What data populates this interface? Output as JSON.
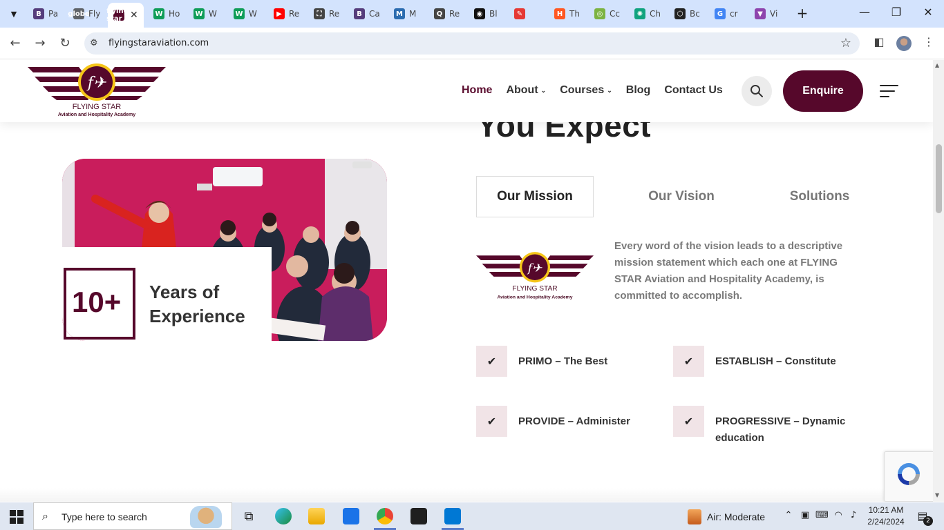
{
  "browser": {
    "tabs": [
      {
        "title": "Pa",
        "favicon": "B",
        "color": "#563d7c"
      },
      {
        "title": "Fly",
        "favicon": "globe",
        "color": "#5f6368"
      },
      {
        "title": "",
        "favicon": "flying-star",
        "color": "#56082b",
        "active": true
      },
      {
        "title": "Ho",
        "favicon": "W",
        "color": "#0f9d58"
      },
      {
        "title": "W",
        "favicon": "W",
        "color": "#0f9d58"
      },
      {
        "title": "W",
        "favicon": "W",
        "color": "#0f9d58"
      },
      {
        "title": "Re",
        "favicon": "▶",
        "color": "#ff0000"
      },
      {
        "title": "Re",
        "favicon": "⛶",
        "color": "#444444"
      },
      {
        "title": "Ca",
        "favicon": "B",
        "color": "#563d7c"
      },
      {
        "title": "M",
        "favicon": "M",
        "color": "#2b6cb0"
      },
      {
        "title": "Re",
        "favicon": "Q",
        "color": "#444444"
      },
      {
        "title": "Bl",
        "favicon": "◉",
        "color": "#111111"
      },
      {
        "title": "",
        "favicon": "✎",
        "color": "#e53935"
      },
      {
        "title": "Th",
        "favicon": "H",
        "color": "#ff5722"
      },
      {
        "title": "Cc",
        "favicon": "◎",
        "color": "#7cb342"
      },
      {
        "title": "Ch",
        "favicon": "✺",
        "color": "#10a37f"
      },
      {
        "title": "Bc",
        "favicon": "⬡",
        "color": "#222222"
      },
      {
        "title": "cr",
        "favicon": "G",
        "color": "#4285f4"
      },
      {
        "title": "Vi",
        "favicon": "▼",
        "color": "#8e44ad"
      }
    ],
    "active_close": "✕",
    "new_tab": "+",
    "url": "flyingstaraviation.com"
  },
  "site": {
    "brand": "FLYING STAR",
    "tagline": "Aviation and Hospitality Academy",
    "nav": [
      {
        "label": "Home",
        "active": true,
        "caret": false
      },
      {
        "label": "About",
        "caret": true
      },
      {
        "label": "Courses",
        "caret": true
      },
      {
        "label": "Blog",
        "caret": false
      },
      {
        "label": "Contact Us",
        "caret": false
      }
    ],
    "enquire": "Enquire",
    "colors": {
      "brand": "#56082b",
      "pink_wall": "#c91d5c",
      "check_bg": "#f1e4e7"
    }
  },
  "section": {
    "heading": "You Expect",
    "experience": {
      "number": "10+",
      "label": "Years of Experience"
    },
    "tabs": [
      {
        "label": "Our Mission",
        "active": true
      },
      {
        "label": "Our Vision"
      },
      {
        "label": "Solutions"
      }
    ],
    "mission_text": "Every word of the vision leads to a descriptive mission statement which each one at FLYING STAR Aviation and Hospitality Academy, is committed to accomplish.",
    "features": [
      "PRIMO – The Best",
      "ESTABLISH – Constitute",
      "PROVIDE – Administer",
      "PROGRESSIVE – Dynamic education"
    ]
  },
  "taskbar": {
    "search_placeholder": "Type here to search",
    "weather": "Air: Moderate",
    "time": "10:21 AM",
    "date": "2/24/2024",
    "notifications": "2"
  }
}
